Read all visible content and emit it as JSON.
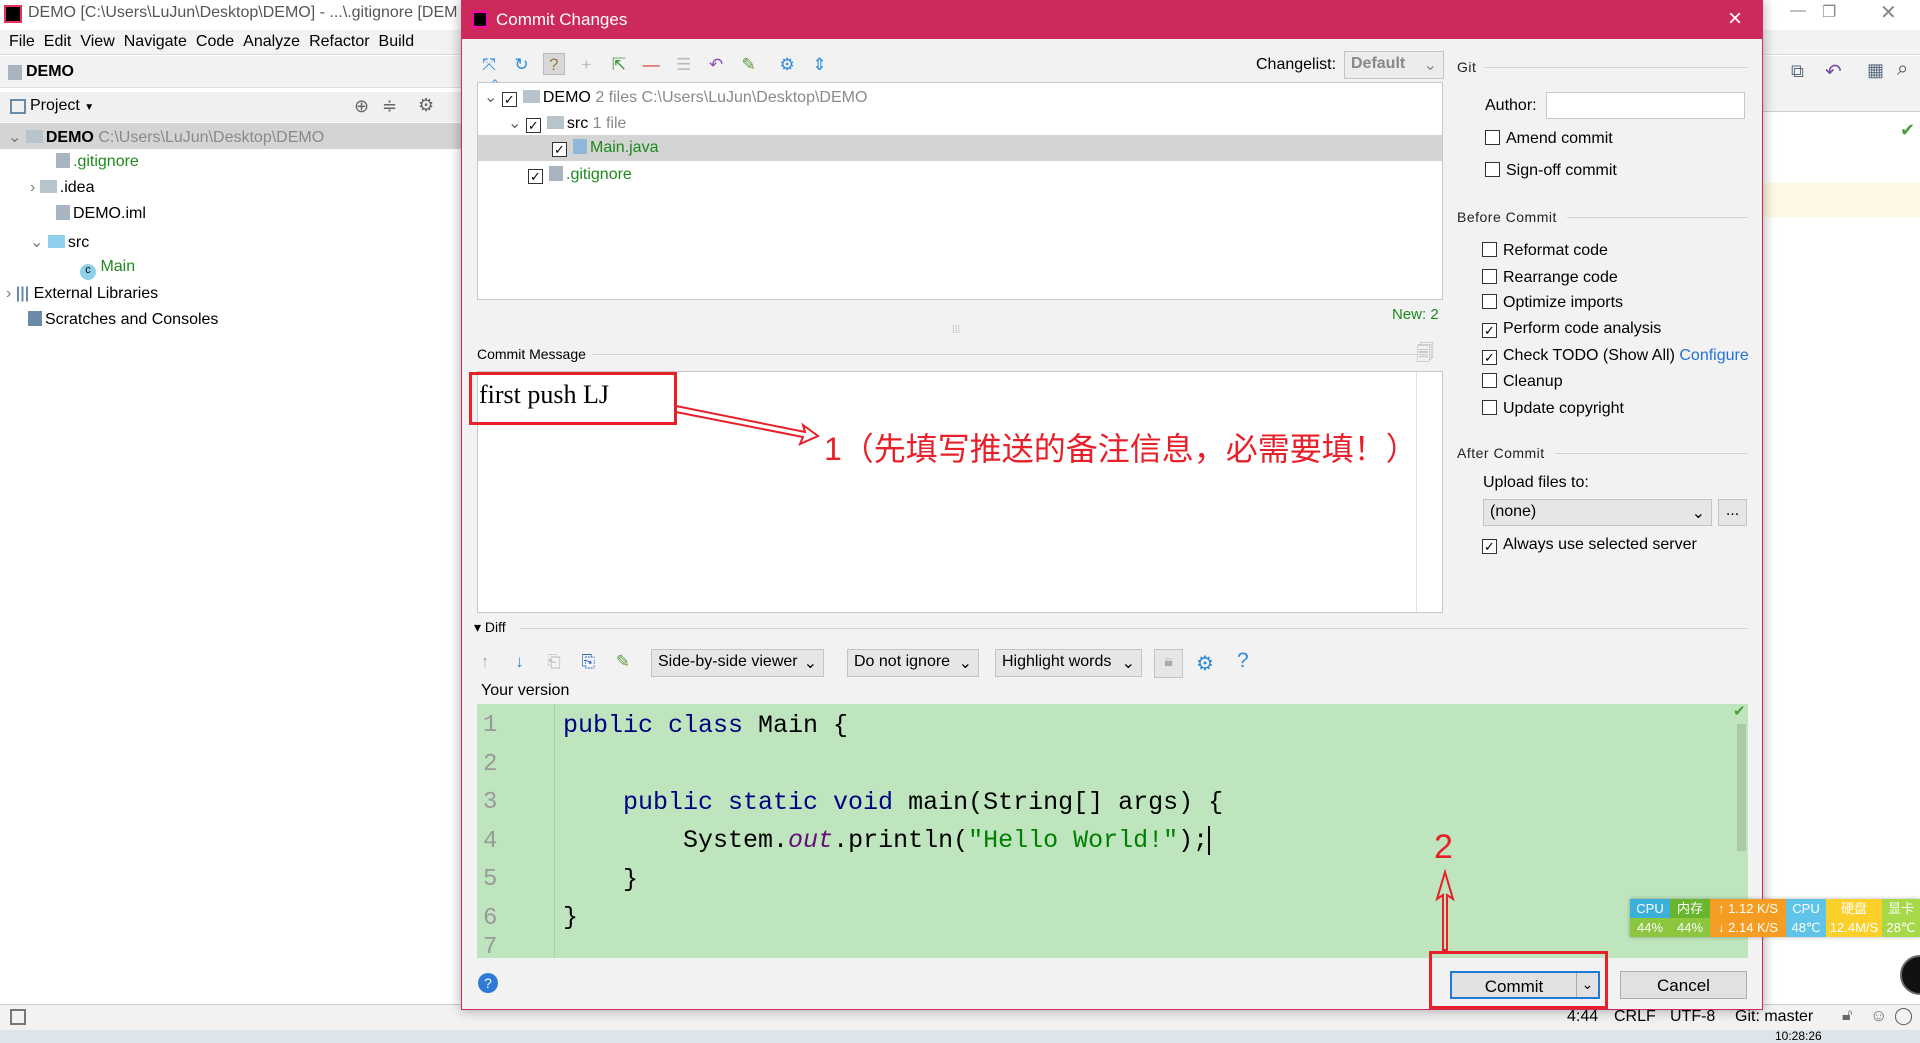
{
  "ide": {
    "title": "DEMO [C:\\Users\\LuJun\\Desktop\\DEMO] - ...\\.gitignore [DEM",
    "menu": [
      "File",
      "Edit",
      "View",
      "Navigate",
      "Code",
      "Analyze",
      "Refactor",
      "Build"
    ],
    "nav": "DEMO",
    "project_label": "Project",
    "tree": [
      {
        "name": "DEMO",
        "hint": "C:\\Users\\LuJun\\Desktop\\DEMO"
      },
      {
        "name": ".gitignore"
      },
      {
        "name": ".idea"
      },
      {
        "name": "DEMO.iml"
      },
      {
        "name": "src"
      },
      {
        "name": "Main"
      },
      {
        "name": "External Libraries"
      },
      {
        "name": "Scratches and Consoles"
      }
    ],
    "status": {
      "position": "4:44",
      "line_sep": "CRLF",
      "encoding": "UTF-8",
      "vcs": "Git: master"
    },
    "clock": "10:28:26"
  },
  "dialog": {
    "title": "Commit Changes",
    "close": "×",
    "changelist_label": "Changelist:",
    "changelist_value": "Default",
    "files": [
      {
        "name": "DEMO",
        "hint": "2 files  C:\\Users\\LuJun\\Desktop\\DEMO",
        "checked": true
      },
      {
        "name": "src",
        "hint": "1 file",
        "checked": true
      },
      {
        "name": "Main.java",
        "checked": true
      },
      {
        "name": ".gitignore",
        "checked": true
      }
    ],
    "new_count": "New: 2",
    "commit_message_label": "Commit Message",
    "commit_message": "first push LJ",
    "diff_label": "Diff",
    "viewer": "Side-by-side viewer",
    "ignore": "Do not ignore",
    "highlight": "Highlight words",
    "help": "?",
    "your_version": "Your version",
    "line_numbers": [
      "1",
      "2",
      "3",
      "4",
      "5",
      "6",
      "7"
    ],
    "code": {
      "l1a": "public class ",
      "l1b": "Main {",
      "l3a": "    public static void ",
      "l3b": "main(String[] args) {",
      "l4a": "        System.",
      "l4b": "out",
      "l4c": ".println(",
      "l4d": "\"Hello World!\"",
      "l4e": ");",
      "l5": "    }",
      "l6": "}"
    },
    "commit_button": "Commit",
    "cancel_button": "Cancel",
    "git_section": "Git",
    "author_label": "Author:",
    "author_value": "",
    "amend": "Amend commit",
    "signoff": "Sign-off commit",
    "before_section": "Before Commit",
    "before": [
      {
        "label": "Reformat code",
        "checked": false
      },
      {
        "label": "Rearrange code",
        "checked": false
      },
      {
        "label": "Optimize imports",
        "checked": false
      },
      {
        "label": "Perform code analysis",
        "checked": true
      },
      {
        "label": "Check TODO (Show All)",
        "checked": true
      },
      {
        "label": "Cleanup",
        "checked": false
      },
      {
        "label": "Update copyright",
        "checked": false
      }
    ],
    "configure_link": "Configure",
    "after_section": "After Commit",
    "upload_label": "Upload files to:",
    "upload_value": "(none)",
    "more": "...",
    "always_server": "Always use selected server"
  },
  "annotations": {
    "note1": "1（先填写推送的备注信息，必需要填！）",
    "note2": "2",
    "color": "#e8202a"
  },
  "monitor": {
    "cpu_label": "CPU",
    "cpu": "44%",
    "mem_label": "内存",
    "mem": "44%",
    "up": "1.12 K/S",
    "down": "2.14 K/S",
    "cpu_temp_label": "CPU",
    "cpu_temp": "48℃",
    "disk_label": "硬盘",
    "disk": "12.4M/S",
    "gpu_label": "显卡",
    "gpu": "28℃"
  },
  "colors": {
    "dialog_title": "#cc2a5b",
    "diff_bg": "#bee5bd",
    "link": "#2470d6"
  }
}
